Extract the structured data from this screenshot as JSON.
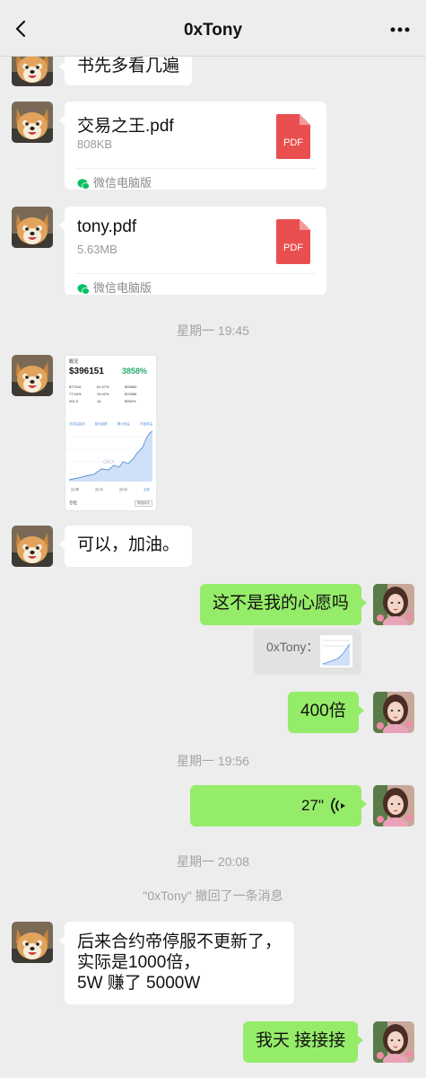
{
  "header": {
    "title": "0xTony"
  },
  "messages": {
    "m1": {
      "text": "书先多看几遍"
    },
    "file1": {
      "name": "交易之王.pdf",
      "size": "808KB",
      "source": "微信电脑版",
      "type_label": "PDF"
    },
    "file2": {
      "name": "tony.pdf",
      "size": "5.63MB",
      "source": "微信电脑版",
      "type_label": "PDF"
    },
    "ts1": "星期一 19:45",
    "screenshot": {
      "section": "概况",
      "total": "$396151",
      "pct": "3858%",
      "stats": [
        "$77016",
        "61.97%",
        "$39560",
        "77.94%",
        "19.42%",
        "$70966",
        "491.5",
        "1d",
        "$260%"
      ],
      "tabs": [
        "总收益曲线",
        "盈利金额",
        "累计收益",
        "市值收益"
      ],
      "watermark": "OKX",
      "periods": [
        "近1周",
        "近1月",
        "近3月",
        "全部"
      ],
      "position_label": "仓位",
      "filter_label": "筛选持仓"
    },
    "m2": {
      "text": "可以，加油。"
    },
    "m3": {
      "text": "这不是我的心愿吗"
    },
    "quote": {
      "text": "0xTony："
    },
    "m4": {
      "text": "400倍"
    },
    "ts2": "星期一 19:56",
    "voice": {
      "duration": "27\""
    },
    "ts3": "星期一 20:08",
    "recall": "\"0xTony\" 撤回了一条消息",
    "m5": {
      "lines": [
        "后来合约帝停服不更新了，",
        "实际是1000倍，",
        "5W 赚了 5000W"
      ]
    },
    "m6": {
      "text": "我天 接接接"
    }
  },
  "colors": {
    "background": "#ededed",
    "self_bubble": "#95ec69",
    "other_bubble": "#ffffff",
    "pdf_red": "#e94f4f",
    "wechat_green": "#07c160"
  },
  "icons": [
    "back-arrow-icon",
    "more-dots-icon",
    "pdf-icon",
    "wechat-pc-icon",
    "voice-wave-icon"
  ]
}
